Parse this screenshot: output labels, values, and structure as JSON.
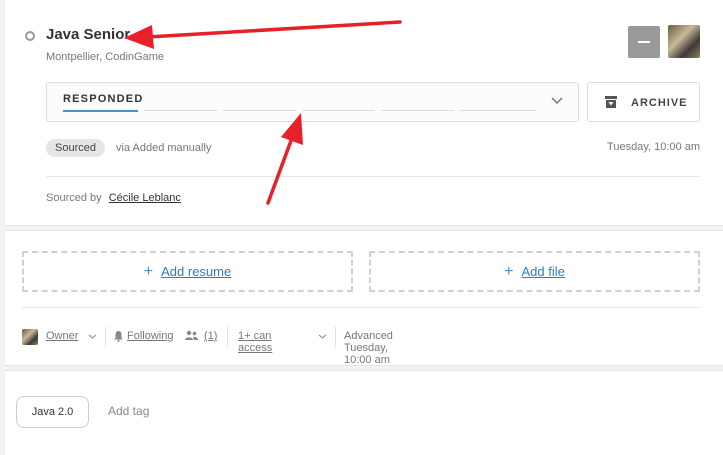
{
  "candidate": {
    "name": "Java Senior",
    "location_company": "Montpellier, CodinGame"
  },
  "stage": {
    "current_label": "RESPONDED",
    "segment_count": 6,
    "active_segment": 1
  },
  "archive_button": {
    "label": "ARCHIVE",
    "icon": "archive-icon"
  },
  "source": {
    "badge": "Sourced",
    "via_text": "via Added manually",
    "timestamp": "Tuesday, 10:00 am",
    "sourced_by_label": "Sourced by",
    "sourced_by_name": "Cécile Leblanc"
  },
  "attachments": {
    "resume_label": "Add resume",
    "file_label": "Add file",
    "plus_icon": "plus-icon"
  },
  "meta": {
    "owner_label": "Owner",
    "following_label": "Following",
    "followers_count": "(1)",
    "access_label": "1+ can access",
    "advanced_text": "Advanced Tuesday, 10:00 am"
  },
  "tags": {
    "items": [
      "Java 2.0"
    ],
    "add_placeholder": "Add tag"
  },
  "colors": {
    "accent": "#4a90c8",
    "link": "#2a7ec2",
    "annotation_arrow": "#e8202a"
  }
}
